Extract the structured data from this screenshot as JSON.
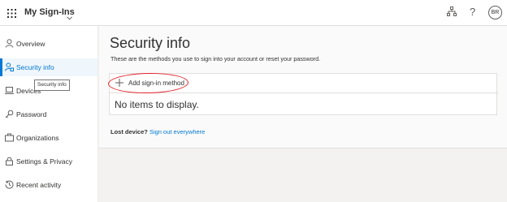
{
  "header": {
    "app_title": "My Sign-Ins",
    "avatar_initials": "BR",
    "help_glyph": "?",
    "icons": [
      "app-launcher-icon",
      "chevron-down-icon",
      "organization-icon",
      "help-icon"
    ]
  },
  "sidebar": {
    "items": [
      {
        "label": "Overview",
        "icon": "person-icon",
        "active": false
      },
      {
        "label": "Security info",
        "icon": "security-info-icon",
        "active": true
      },
      {
        "label": "Devices",
        "icon": "laptop-icon",
        "active": false
      },
      {
        "label": "Password",
        "icon": "key-icon",
        "active": false
      },
      {
        "label": "Organizations",
        "icon": "briefcase-icon",
        "active": false
      },
      {
        "label": "Settings & Privacy",
        "icon": "lock-icon",
        "active": false
      },
      {
        "label": "Recent activity",
        "icon": "history-icon",
        "active": false
      }
    ],
    "tooltip": "Security info"
  },
  "main": {
    "title": "Security info",
    "description": "These are the methods you use to sign into your account or reset your password.",
    "add_method_label": "Add sign-in method",
    "empty_message": "No items to display.",
    "lost_device_label": "Lost device?",
    "sign_out_link": "Sign out everywhere"
  },
  "colors": {
    "accent": "#0078d4",
    "annotation": "#e3242b",
    "active_bg": "#eff6fc"
  }
}
